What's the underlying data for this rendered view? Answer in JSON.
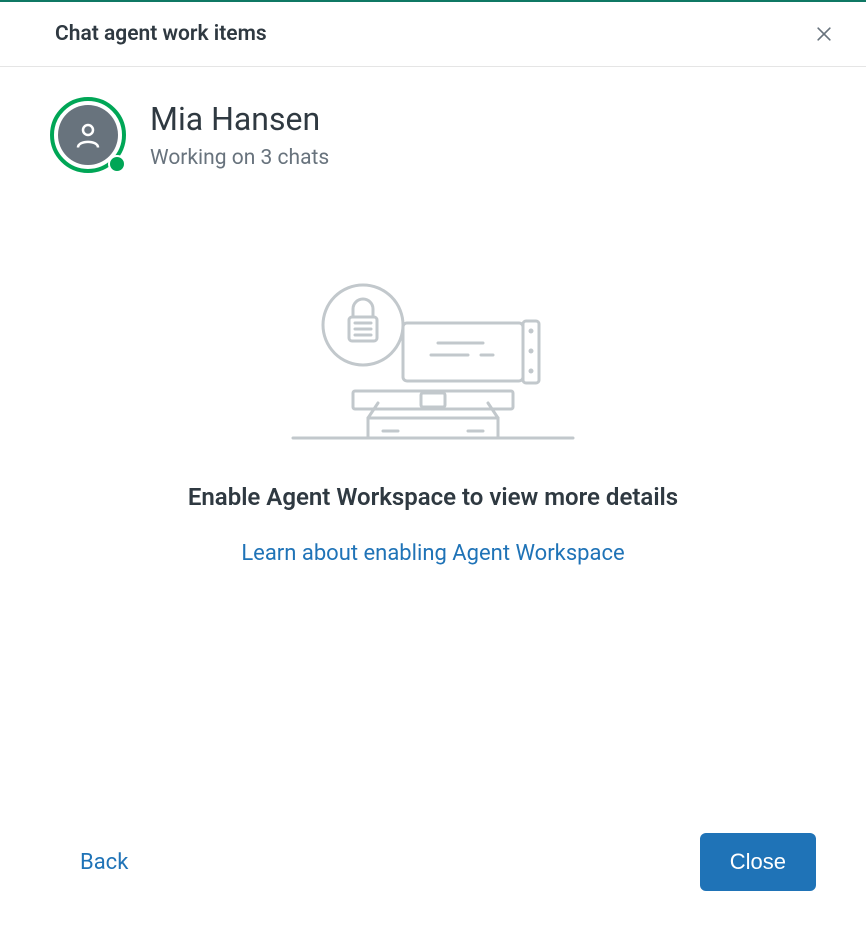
{
  "header": {
    "title": "Chat agent work items"
  },
  "agent": {
    "name": "Mia Hansen",
    "status": "Working on 3 chats"
  },
  "emptyState": {
    "heading": "Enable Agent Workspace to view more details",
    "linkText": "Learn about enabling Agent Workspace"
  },
  "footer": {
    "backLabel": "Back",
    "closeLabel": "Close"
  }
}
